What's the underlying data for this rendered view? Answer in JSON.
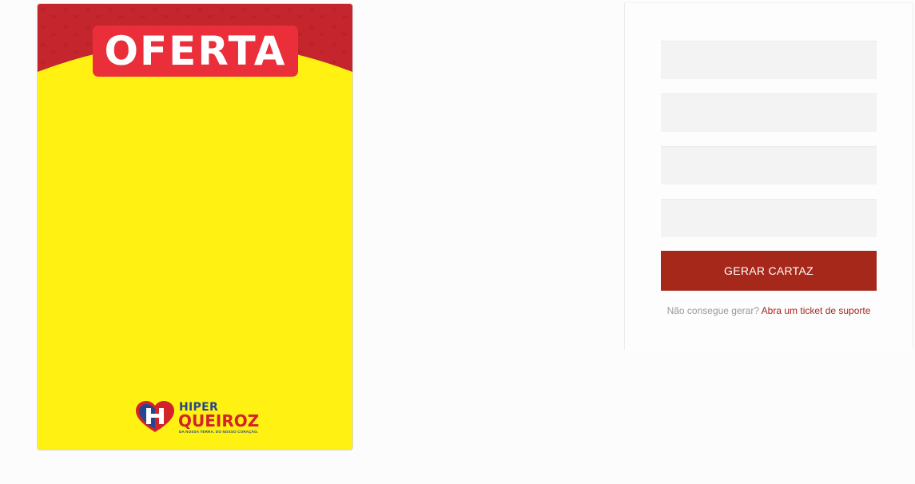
{
  "poster": {
    "badge_text": "OFERTA",
    "logo": {
      "line1": "HIPER",
      "line2": "QUEIROZ",
      "tagline": "DA NOSSA TERRA. DO NOSSO CORAÇÃO."
    },
    "colors": {
      "background": "#fff212",
      "banner": "#c5262d",
      "badge": "#ea2e3a"
    }
  },
  "form": {
    "fields": [
      {
        "value": "",
        "placeholder": ""
      },
      {
        "value": "",
        "placeholder": ""
      },
      {
        "value": "",
        "placeholder": ""
      },
      {
        "value": "",
        "placeholder": ""
      }
    ],
    "submit_label": "GERAR CARTAZ",
    "support_prefix": "Não consegue gerar?",
    "support_link": "Abra um ticket de suporte",
    "colors": {
      "accent": "#a6281a"
    }
  }
}
